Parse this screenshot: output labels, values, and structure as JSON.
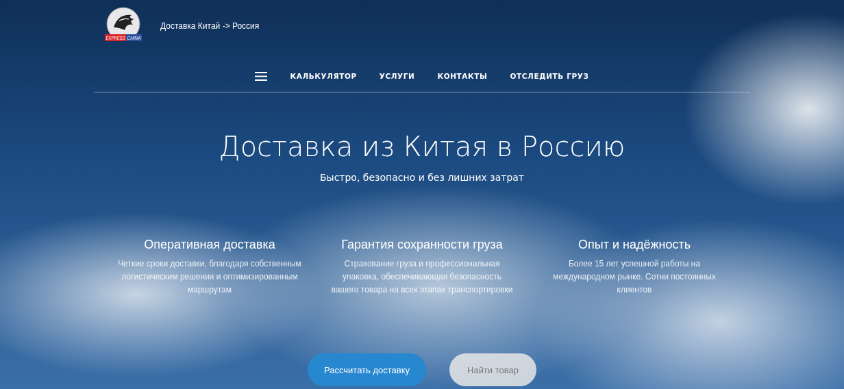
{
  "header": {
    "logo_words": [
      "EXPRESS",
      "CHINA"
    ],
    "tagline": "Доставка Китай -> Россия"
  },
  "nav": {
    "items": [
      {
        "label": "КАЛЬКУЛЯТОР"
      },
      {
        "label": "УСЛУГИ"
      },
      {
        "label": "КОНТАКТЫ"
      },
      {
        "label": "ОТСЛЕДИТЬ ГРУЗ"
      }
    ]
  },
  "hero": {
    "title": "Доставка из Китая в Россию",
    "subtitle": "Быстро, безопасно и без лишних затрат"
  },
  "features": [
    {
      "title": "Оперативная доставка",
      "text": "Четкие сроки доставки, благодаря собственным логистическим решения и оптимизированным маршрутам"
    },
    {
      "title": "Гарантия сохранности груза",
      "text": "Страхование груза и профессиональная упаковка, обеспечивающая безопасность вашего товара на всех этапах транспортировки"
    },
    {
      "title": "Опыт и надёжность",
      "text": "Более 15 лет успешной работы на международном рынке. Сотни постоянных клиентов"
    }
  ],
  "buttons": [
    {
      "label": "Рассчитать доставку",
      "kind": "primary"
    },
    {
      "label": "Найти товар",
      "kind": "secondary"
    }
  ]
}
